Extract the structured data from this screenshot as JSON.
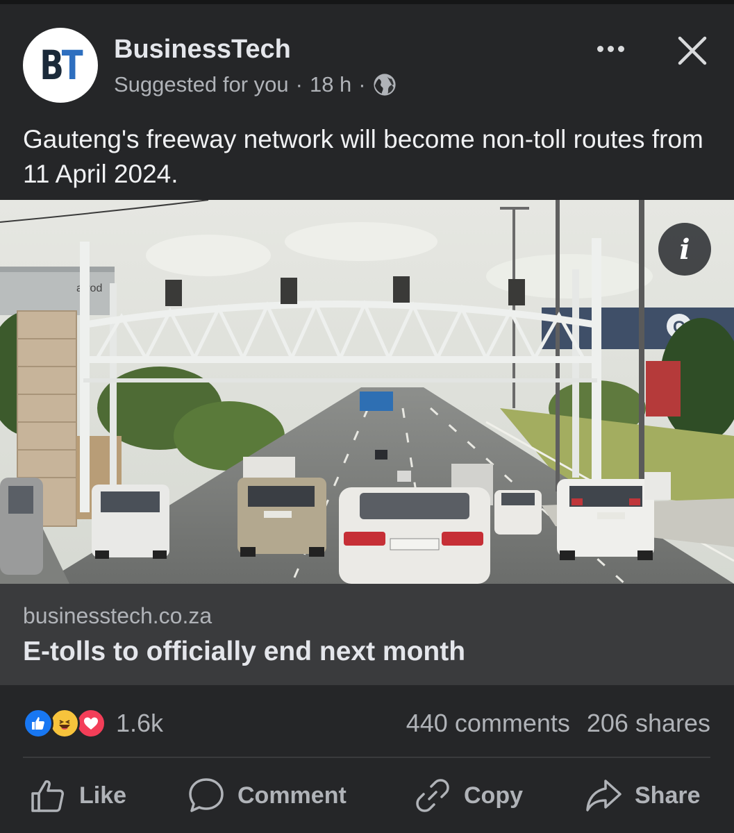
{
  "post": {
    "page_name": "BusinessTech",
    "avatar_text_b": "B",
    "avatar_text_t": "T",
    "suggested": "Suggested for you",
    "separator": "·",
    "time": "18 h",
    "caption": "Gauteng's freeway network will become non-toll routes from 11 April 2024.",
    "privacy_icon": "globe-icon",
    "more_icon": "more-horizontal-icon",
    "close_icon": "close-icon"
  },
  "image": {
    "info_label": "i",
    "building_sign": "arrod"
  },
  "link": {
    "domain": "businesstech.co.za",
    "title": "E-tolls to officially end next month"
  },
  "stats": {
    "reactions_count": "1.6k",
    "comments": "440 comments",
    "shares": "206 shares",
    "reaction_icons": [
      "like-reaction-icon",
      "haha-reaction-icon",
      "love-reaction-icon"
    ]
  },
  "actions": {
    "like": "Like",
    "comment": "Comment",
    "copy": "Copy",
    "share": "Share"
  },
  "colors": {
    "background": "#252628",
    "link_box": "#3a3b3d",
    "primary_text": "#e4e6eb",
    "secondary_text": "#b0b3b8",
    "like_blue": "#1877f2",
    "love_red": "#f33e58",
    "haha_yellow": "#f7c33c"
  }
}
